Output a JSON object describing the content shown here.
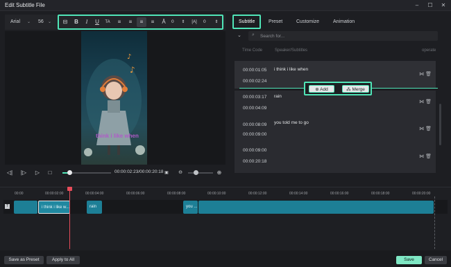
{
  "window": {
    "title": "Edit Subtitle File",
    "minimize_icon": "minimize-icon",
    "maximize_icon": "maximize-icon",
    "close_icon": "close-icon"
  },
  "toolbar": {
    "font": "Arial",
    "size": "56",
    "letter_spacing": "0",
    "line_spacing": "0",
    "icons": [
      "text-style-icon",
      "bold-icon",
      "italic-icon",
      "underline-icon",
      "font-case-icon",
      "align-left-icon",
      "align-center-icon",
      "align-justify-icon",
      "align-right-icon",
      "baseline-icon",
      "stepper-icon",
      "line-height-icon",
      "stepper-icon"
    ]
  },
  "preview": {
    "subtitle_text": "think i like when"
  },
  "playback": {
    "timecode": "00:00:02:23/00:00:20:18",
    "progress": 0.14,
    "controls": [
      "prev-frame-icon",
      "next-frame-icon",
      "play-icon",
      "stop-icon"
    ]
  },
  "tabs": [
    {
      "label": "Subtitle",
      "active": true
    },
    {
      "label": "Preset",
      "active": false
    },
    {
      "label": "Customize",
      "active": false
    },
    {
      "label": "Animation",
      "active": false
    }
  ],
  "search": {
    "placeholder": "Search for..."
  },
  "table": {
    "headers": {
      "timecode": "Time Code",
      "text": "Speaker/Subtitles",
      "operate": "operate"
    },
    "rows": [
      {
        "start": "00:00:01:05",
        "end": "00:00:02:24",
        "text": "i think i like when"
      },
      {
        "start": "00:00:03:17",
        "end": "00:00:04:09",
        "text": "rain"
      },
      {
        "start": "00:00:08:09",
        "end": "00:00:09:00",
        "text": "you told me to go"
      },
      {
        "start": "00:00:09:00",
        "end": "00:00:20:18",
        "text": ""
      }
    ]
  },
  "insert": {
    "add_label": "Add",
    "merge_label": "Merge"
  },
  "timeline": {
    "ticks": [
      "00:00",
      "00:00:02:00",
      "00:00:04:00",
      "00:00:06:00",
      "00:00:08:00",
      "00:00:10:00",
      "00:00:12:00",
      "00:00:14:00",
      "00:00:16:00",
      "00:00:18:00",
      "00:00:20:00"
    ],
    "clips": [
      {
        "label": ""
      },
      {
        "label": "i think i like w..."
      },
      {
        "label": "rain"
      },
      {
        "label": "you ..."
      },
      {
        "label": ""
      }
    ]
  },
  "footer": {
    "save_preset": "Save as Preset",
    "apply_all": "Apply to All",
    "save": "Save",
    "cancel": "Cancel"
  },
  "colors": {
    "accent": "#50e6b8",
    "clip": "#1d7f96",
    "playhead": "#e74c5a"
  }
}
